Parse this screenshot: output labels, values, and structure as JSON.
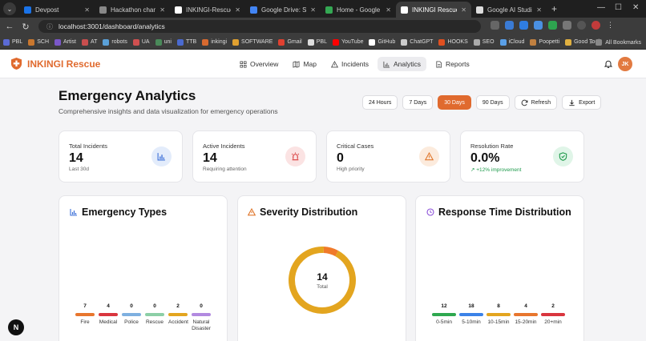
{
  "browser": {
    "tabs": [
      {
        "title": "Devpost",
        "color": "#1a73e8",
        "active": false
      },
      {
        "title": "Hackathon chances",
        "color": "#888888",
        "active": false
      },
      {
        "title": "INKINGI-Rescue/INKI",
        "color": "#ffffff",
        "active": false
      },
      {
        "title": "Google Drive: Share",
        "color": "#4285f4",
        "active": false
      },
      {
        "title": "Home - Google Drive",
        "color": "#34a853",
        "active": false
      },
      {
        "title": "INKINGI Rescue - Re",
        "color": "#ffffff",
        "active": true
      },
      {
        "title": "Google AI Studio",
        "color": "#dddddd",
        "active": false
      }
    ],
    "url": "localhost:3001/dashboard/analytics",
    "profile_initial": "",
    "bookmarks": [
      {
        "label": "PBL",
        "color": "#5b6bd6"
      },
      {
        "label": "SCH",
        "color": "#c9772e"
      },
      {
        "label": "Artist",
        "color": "#7a57c9"
      },
      {
        "label": "AT",
        "color": "#c94e4e"
      },
      {
        "label": "robots",
        "color": "#5aa0d8"
      },
      {
        "label": "UA",
        "color": "#d05050"
      },
      {
        "label": "uni",
        "color": "#4a8a5a"
      },
      {
        "label": "TTB",
        "color": "#4a6ad0"
      },
      {
        "label": "inkingi",
        "color": "#d86a30"
      },
      {
        "label": "SOFTWARE",
        "color": "#e0a030"
      },
      {
        "label": "Gmail",
        "color": "#e04030"
      },
      {
        "label": "PBL",
        "color": "#dddddd"
      },
      {
        "label": "YouTube",
        "color": "#ff0000"
      },
      {
        "label": "GitHub",
        "color": "#ffffff"
      },
      {
        "label": "ChatGPT",
        "color": "#cccccc"
      },
      {
        "label": "HOOKS",
        "color": "#e05020"
      },
      {
        "label": "SEO",
        "color": "#aaaaaa"
      },
      {
        "label": "iCloud",
        "color": "#5aa0e8"
      },
      {
        "label": "Poopetti",
        "color": "#c08040"
      },
      {
        "label": "Good Tools",
        "color": "#e0b040"
      }
    ],
    "all_bookmarks": "All Bookmarks"
  },
  "app": {
    "brand": "INKINGI Rescue",
    "brand_color": "#e06a2e",
    "nav": [
      {
        "label": "Overview",
        "icon": "grid-icon",
        "active": false
      },
      {
        "label": "Map",
        "icon": "map-icon",
        "active": false
      },
      {
        "label": "Incidents",
        "icon": "alert-triangle-icon",
        "active": false
      },
      {
        "label": "Analytics",
        "icon": "bar-chart-icon",
        "active": true
      },
      {
        "label": "Reports",
        "icon": "document-icon",
        "active": false
      }
    ],
    "avatar_initials": "JK"
  },
  "page": {
    "title": "Emergency Analytics",
    "subtitle": "Comprehensive insights and data visualization for emergency operations",
    "ranges": [
      "24 Hours",
      "7 Days",
      "30 Days",
      "90 Days"
    ],
    "active_range": "30 Days",
    "refresh_label": "Refresh",
    "export_label": "Export"
  },
  "stats": [
    {
      "label": "Total Incidents",
      "value": "14",
      "note": "Last 30d",
      "icon": "bar-chart-icon",
      "icon_color": "#3b6fd8",
      "icon_bg": "#e3ecfb",
      "note_good": false
    },
    {
      "label": "Active Incidents",
      "value": "14",
      "note": "Requiring attention",
      "icon": "siren-icon",
      "icon_color": "#d83b3b",
      "icon_bg": "#fbe3e3",
      "note_good": false
    },
    {
      "label": "Critical Cases",
      "value": "0",
      "note": "High priority",
      "icon": "alert-triangle-icon",
      "icon_color": "#e0782e",
      "icon_bg": "#fcebdd",
      "note_good": false
    },
    {
      "label": "Resolution Rate",
      "value": "0.0%",
      "note": "+12% improvement",
      "icon": "shield-check-icon",
      "icon_color": "#1e9a4b",
      "icon_bg": "#e0f5e8",
      "note_good": true
    }
  ],
  "panels": {
    "types_title": "Emergency Types",
    "severity_title": "Severity Distribution",
    "response_title": "Response Time Distribution"
  },
  "chart_data": [
    {
      "type": "bar",
      "categories": [
        "Fire",
        "Medical",
        "Police",
        "Rescue",
        "Accident",
        "Natural Disaster"
      ],
      "values": [
        7,
        4,
        0,
        0,
        2,
        0
      ],
      "colors": [
        "#e8762e",
        "#d9363e",
        "#7eb0e0",
        "#8ccfa6",
        "#e3a51f",
        "#b28ae0"
      ]
    },
    {
      "type": "pie",
      "categories": [
        "",
        ""
      ],
      "values": [
        13,
        1
      ],
      "colors": [
        "#e3a51f",
        "#f07a2a"
      ],
      "center_value": "14",
      "center_label": "Total"
    },
    {
      "type": "bar",
      "categories": [
        "0-5min",
        "5-10min",
        "10-15min",
        "15-20min",
        "20+min"
      ],
      "values": [
        12,
        18,
        8,
        4,
        2
      ],
      "colors": [
        "#2fa84f",
        "#3b82e8",
        "#e3a51f",
        "#e8762e",
        "#d9363e"
      ]
    }
  ],
  "fab_label": "N"
}
